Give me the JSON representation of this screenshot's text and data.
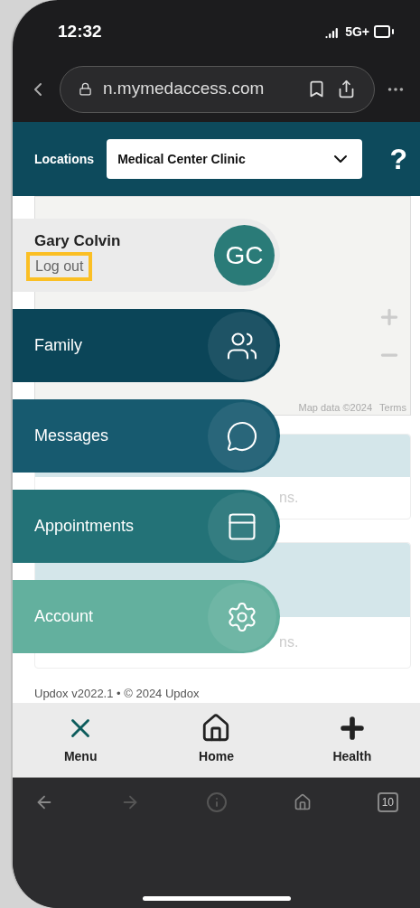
{
  "status_bar": {
    "time": "12:32",
    "network": "5G+"
  },
  "browser": {
    "url": "n.mymedaccess.com",
    "tab_count": "10"
  },
  "header": {
    "label": "Locations",
    "location": "Medical Center Clinic",
    "help": "?"
  },
  "map": {
    "attribution": "Map data ©2024",
    "terms": "Terms"
  },
  "cards": [
    {
      "text": "ns."
    },
    {
      "text": "ns."
    }
  ],
  "user": {
    "name": "Gary Colvin",
    "initials": "GC",
    "logout": "Log out",
    "logout_highlighted": true
  },
  "menu": [
    {
      "label": "Family",
      "kind": "family",
      "color": "#0b4558"
    },
    {
      "label": "Messages",
      "kind": "messages",
      "color": "#175a6f"
    },
    {
      "label": "Appointments",
      "kind": "appointments",
      "color": "#237277"
    },
    {
      "label": "Account",
      "kind": "account",
      "color": "#63b09e"
    }
  ],
  "footer": "Updox v2022.1 • © 2024 Updox",
  "bottom_nav": [
    {
      "label": "Menu",
      "kind": "close",
      "selected": true
    },
    {
      "label": "Home",
      "kind": "home",
      "selected": false
    },
    {
      "label": "Health",
      "kind": "plus",
      "selected": false
    }
  ]
}
